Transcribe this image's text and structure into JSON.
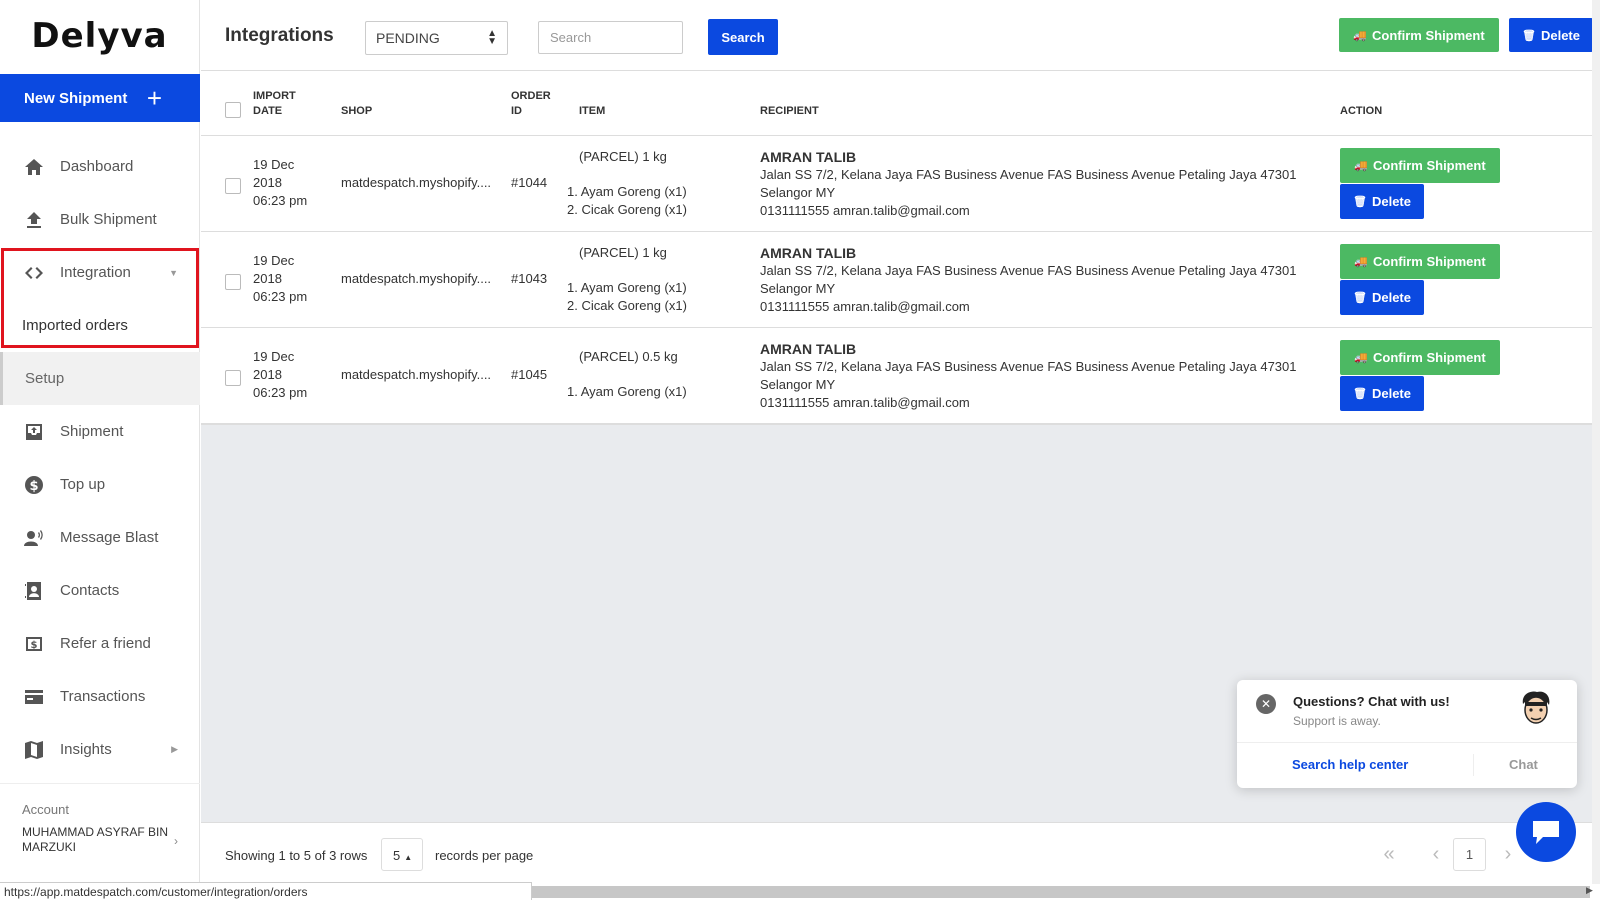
{
  "brand": {
    "logo_text": "Delyva"
  },
  "sidebar": {
    "new_shipment_label": "New Shipment",
    "items": [
      {
        "label": "Dashboard",
        "icon": "home-icon"
      },
      {
        "label": "Bulk Shipment",
        "icon": "upload-icon"
      },
      {
        "label": "Integration",
        "icon": "code-icon"
      },
      {
        "label": "Imported orders"
      },
      {
        "label": "Setup"
      },
      {
        "label": "Shipment",
        "icon": "inbox-icon"
      },
      {
        "label": "Top up",
        "icon": "dollar-icon"
      },
      {
        "label": "Message Blast",
        "icon": "speaker-user-icon"
      },
      {
        "label": "Contacts",
        "icon": "contact-card-icon"
      },
      {
        "label": "Refer a friend",
        "icon": "money-icon"
      },
      {
        "label": "Transactions",
        "icon": "card-icon"
      },
      {
        "label": "Insights",
        "icon": "map-icon"
      }
    ],
    "account_label": "Account",
    "account_name": "MUHAMMAD ASYRAF BIN MARZUKI"
  },
  "header": {
    "title": "Integrations",
    "status_value": "PENDING",
    "search_placeholder": "Search",
    "search_button": "Search",
    "confirm_button": "Confirm Shipment",
    "delete_button": "Delete"
  },
  "table": {
    "columns": {
      "import_date_1": "IMPORT",
      "import_date_2": "DATE",
      "shop": "SHOP",
      "order_id_1": "ORDER",
      "order_id_2": "ID",
      "item": "ITEM",
      "recipient": "RECIPIENT",
      "action": "ACTION"
    },
    "rows": [
      {
        "date_1": "19 Dec",
        "date_2": "2018",
        "date_3": "06:23 pm",
        "shop": "matdespatch.myshopify....",
        "order_id": "#1044",
        "parcel": "(PARCEL) 1 kg",
        "items": [
          "1. Ayam Goreng (x1)",
          "2. Cicak Goreng (x1)"
        ],
        "recipient_name": "AMRAN TALIB",
        "address_1": "Jalan SS 7/2, Kelana Jaya FAS Business Avenue FAS Business Avenue Petaling Jaya 47301",
        "address_2": "Selangor MY",
        "contact": "0131111555 amran.talib@gmail.com",
        "confirm": "Confirm Shipment",
        "delete": "Delete"
      },
      {
        "date_1": "19 Dec",
        "date_2": "2018",
        "date_3": "06:23 pm",
        "shop": "matdespatch.myshopify....",
        "order_id": "#1043",
        "parcel": "(PARCEL) 1 kg",
        "items": [
          "1. Ayam Goreng (x1)",
          "2. Cicak Goreng (x1)"
        ],
        "recipient_name": "AMRAN TALIB",
        "address_1": "Jalan SS 7/2, Kelana Jaya FAS Business Avenue FAS Business Avenue Petaling Jaya 47301",
        "address_2": "Selangor MY",
        "contact": "0131111555 amran.talib@gmail.com",
        "confirm": "Confirm Shipment",
        "delete": "Delete"
      },
      {
        "date_1": "19 Dec",
        "date_2": "2018",
        "date_3": "06:23 pm",
        "shop": "matdespatch.myshopify....",
        "order_id": "#1045",
        "parcel": "(PARCEL) 0.5 kg",
        "items": [
          "1. Ayam Goreng (x1)"
        ],
        "recipient_name": "AMRAN TALIB",
        "address_1": "Jalan SS 7/2, Kelana Jaya FAS Business Avenue FAS Business Avenue Petaling Jaya 47301",
        "address_2": "Selangor MY",
        "contact": "0131111555 amran.talib@gmail.com",
        "confirm": "Confirm Shipment",
        "delete": "Delete"
      }
    ]
  },
  "footer": {
    "showing": "Showing 1 to 5 of 3 rows",
    "per_page_value": "5",
    "per_page_label": "records per page",
    "current_page": "1"
  },
  "statusbar": {
    "url": "https://app.matdespatch.com/customer/integration/orders"
  },
  "chat": {
    "title": "Questions? Chat with us!",
    "subtitle": "Support is away.",
    "help_link": "Search help center",
    "chat_link": "Chat"
  },
  "colors": {
    "primary": "#0b49e0",
    "success": "#4cb963",
    "highlight": "#e0141e"
  }
}
